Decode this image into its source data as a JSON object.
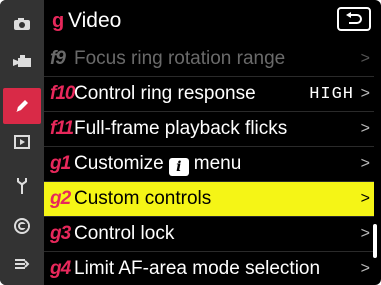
{
  "header": {
    "code": "g",
    "title": "Video"
  },
  "sidebar": {
    "items": [
      {
        "icon": "camera-icon"
      },
      {
        "icon": "video-camera-icon"
      },
      {
        "icon": "pencil-icon",
        "active": true
      },
      {
        "icon": "playback-icon"
      },
      {
        "icon": "wrench-icon"
      },
      {
        "icon": "network-icon"
      },
      {
        "icon": "my-menu-icon"
      }
    ]
  },
  "menu": {
    "items": [
      {
        "code": "f9",
        "label": "Focus ring rotation range",
        "value": "",
        "chevron": ">",
        "disabled": true
      },
      {
        "code": "f10",
        "label": "Control ring response",
        "value": "HIGH",
        "chevron": ">"
      },
      {
        "code": "f11",
        "label": "Full-frame playback flicks",
        "value": "",
        "chevron": ">"
      },
      {
        "code": "g1",
        "label_pre": "Customize",
        "badge": "i",
        "label_post": "menu",
        "value": "",
        "chevron": ">"
      },
      {
        "code": "g2",
        "label": "Custom controls",
        "value": "",
        "chevron": ">",
        "selected": true
      },
      {
        "code": "g3",
        "label": "Control lock",
        "value": "",
        "chevron": ">"
      },
      {
        "code": "g4",
        "label": "Limit AF-area mode selection",
        "value": "",
        "chevron": ">"
      }
    ]
  },
  "colors": {
    "accent": "#e7285b",
    "selected_bg": "#f5f516",
    "active_tab": "#d92a47",
    "sidebar_bg": "#333333"
  }
}
